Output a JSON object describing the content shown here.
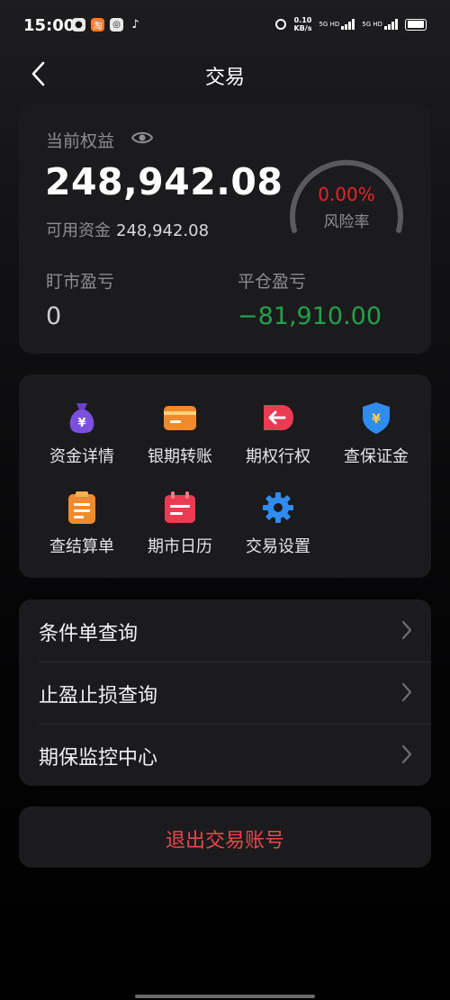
{
  "status_bar": {
    "time": "15:00",
    "net_speed_value": "0.10",
    "net_speed_unit": "KB/s",
    "sim1": "5G HD",
    "sim2": "5G HD",
    "app_icons": [
      "message-icon",
      "taobao-icon",
      "camera-app-icon",
      "tiktok-icon"
    ]
  },
  "nav": {
    "title": "交易"
  },
  "equity": {
    "label": "当前权益",
    "value": "248,942.08",
    "available_label": "可用资金",
    "available_value": "248,942.08",
    "risk_rate": "0.00%",
    "risk_label": "风险率",
    "floating_pl_label": "盯市盈亏",
    "floating_pl_value": "0",
    "closing_pl_label": "平仓盈亏",
    "closing_pl_value": "−81,910.00"
  },
  "functions": [
    {
      "label": "资金详情",
      "icon": "money-bag-icon"
    },
    {
      "label": "银期转账",
      "icon": "card-icon"
    },
    {
      "label": "期权行权",
      "icon": "exercise-arrow-icon"
    },
    {
      "label": "查保证金",
      "icon": "shield-yen-icon"
    },
    {
      "label": "查结算单",
      "icon": "clipboard-icon"
    },
    {
      "label": "期市日历",
      "icon": "calendar-icon"
    },
    {
      "label": "交易设置",
      "icon": "gear-icon"
    }
  ],
  "menu": [
    {
      "label": "条件单查询"
    },
    {
      "label": "止盈止损查询"
    },
    {
      "label": "期保监控中心"
    }
  ],
  "logout": {
    "label": "退出交易账号"
  },
  "colors": {
    "loss_green": "#25a04a",
    "risk_red": "#e5252a",
    "logout_red": "#e5484d",
    "card_bg": "#1b1b1d"
  }
}
